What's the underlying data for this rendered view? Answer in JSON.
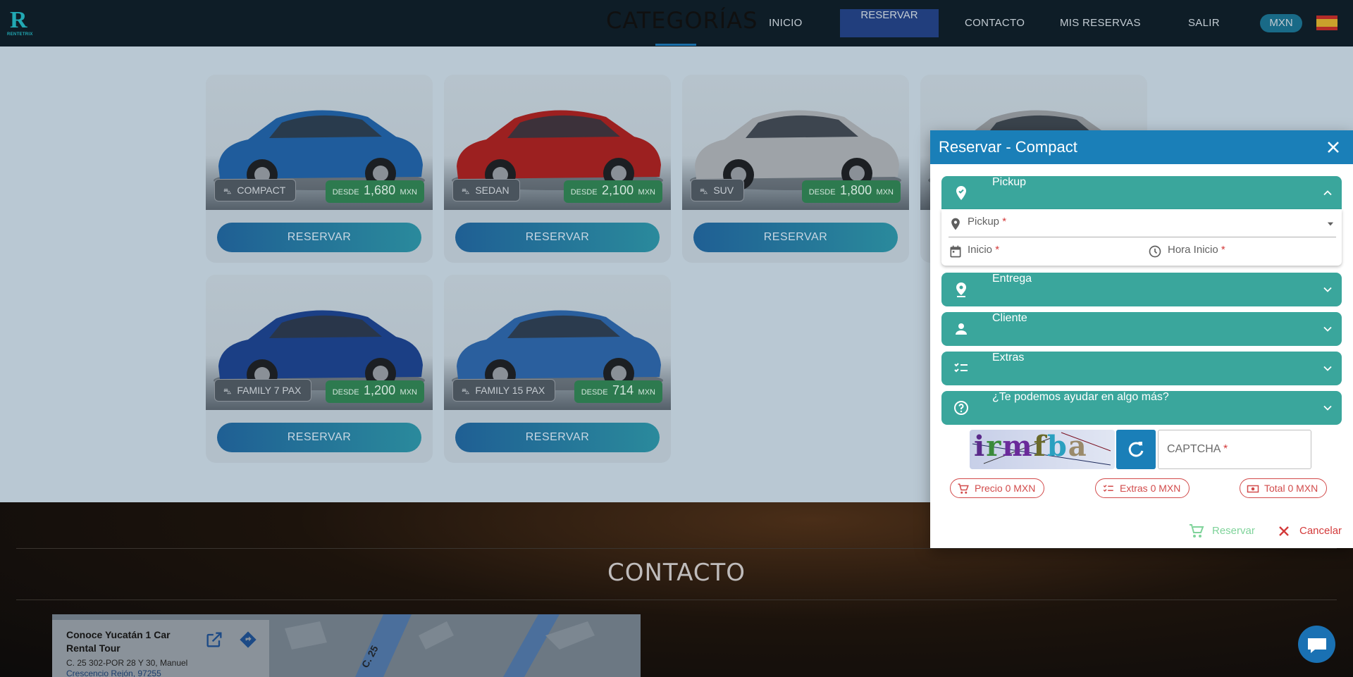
{
  "nav": {
    "logo_text": "RENTETRIX",
    "title": "CATEGORÍAS",
    "links": [
      "INICIO",
      "RESERVAR",
      "CONTACTO",
      "MIS RESERVAS",
      "SALIR"
    ],
    "currency": "MXN",
    "language_flag": "spain-flag-icon"
  },
  "cards": [
    {
      "category": "COMPACT",
      "from": "DESDE",
      "price": "1,680",
      "currency": "MXN",
      "button": "RESERVAR",
      "car_color": "#1f5c9c"
    },
    {
      "category": "SEDAN",
      "from": "DESDE",
      "price": "2,100",
      "currency": "MXN",
      "button": "RESERVAR",
      "car_color": "#9c2020"
    },
    {
      "category": "SUV",
      "from": "DESDE",
      "price": "1,800",
      "currency": "MXN",
      "button": "RESERVAR",
      "car_color": "#9ea3a8"
    },
    {
      "category": "",
      "from": "",
      "price": "",
      "currency": "",
      "button": "",
      "car_color": "#8c9196"
    },
    {
      "category": "FAMILY 7 PAX",
      "from": "DESDE",
      "price": "1,200",
      "currency": "MXN",
      "button": "RESERVAR",
      "car_color": "#1b3f85"
    },
    {
      "category": "FAMILY 15 PAX",
      "from": "DESDE",
      "price": "714",
      "currency": "MXN",
      "button": "RESERVAR",
      "car_color": "#2a5f9e"
    }
  ],
  "contact": {
    "title": "CONTACTO",
    "place_name": "Conoce Yucatán 1 Car Rental Tour",
    "address_line1": "C. 25 302-POR 28 Y 30, Manuel",
    "address_line2": "Crescencio Rejón, 97255",
    "road_label": "C. 25"
  },
  "modal": {
    "title": "Reservar - Compact",
    "sections": {
      "pickup": "Pickup",
      "entrega": "Entrega",
      "cliente": "Cliente",
      "extras": "Extras",
      "ayuda": "¿Te podemos ayudar en algo más?"
    },
    "fields": {
      "pickup": "Pickup",
      "inicio": "Inicio",
      "hora_inicio": "Hora Inicio",
      "required_mark": "*"
    },
    "captcha": {
      "image_text": "irmfba",
      "placeholder": "CAPTCHA",
      "required_mark": "*"
    },
    "summary": {
      "precio": "Precio 0 MXN",
      "extras": "Extras 0 MXN",
      "total": "Total 0 MXN"
    },
    "actions": {
      "reservar": "Reservar",
      "cancelar": "Cancelar"
    }
  },
  "colors": {
    "accent_blue": "#1a7fb8",
    "accordion_teal": "#3aa69c",
    "chip_red": "#d24b4b",
    "reservar_green": "#7fd39a"
  }
}
